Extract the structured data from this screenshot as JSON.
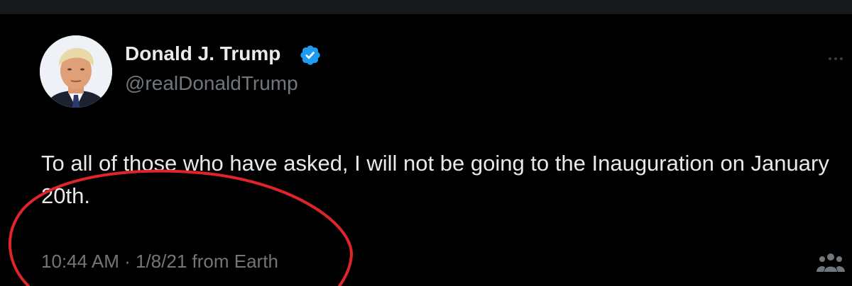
{
  "author": {
    "display_name": "Donald J. Trump",
    "handle": "@realDonaldTrump",
    "verified": true,
    "verified_icon": "verified-badge-icon",
    "verified_color": "#1d9bf0"
  },
  "tweet": {
    "text": "To all of those who have asked, I will not be going to the Inauguration on January 20th.",
    "time": "10:44 AM",
    "separator": "·",
    "date": "1/8/21",
    "source": "from Earth"
  },
  "icons": {
    "more": "more-options-icon",
    "community": "community-notes-icon"
  },
  "colors": {
    "background": "#000000",
    "text_primary": "#e7e9ea",
    "text_secondary": "#71767b",
    "annotation": "#e0242b"
  }
}
